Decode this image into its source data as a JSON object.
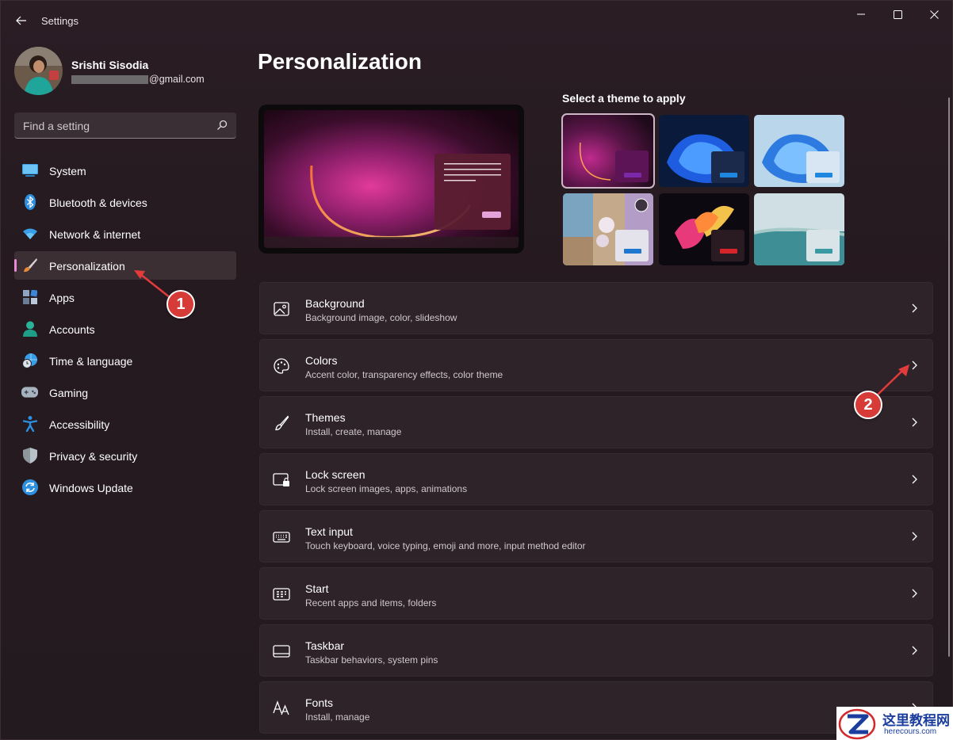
{
  "window": {
    "title": "Settings",
    "controls": [
      "minimize",
      "maximize",
      "close"
    ]
  },
  "profile": {
    "name": "Srishti Sisodia",
    "email_suffix": "@gmail.com"
  },
  "search": {
    "placeholder": "Find a setting"
  },
  "sidebar": {
    "items": [
      {
        "label": "System",
        "icon": "monitor-icon"
      },
      {
        "label": "Bluetooth & devices",
        "icon": "bluetooth-icon"
      },
      {
        "label": "Network & internet",
        "icon": "wifi-icon"
      },
      {
        "label": "Personalization",
        "icon": "paintbrush-icon",
        "active": true
      },
      {
        "label": "Apps",
        "icon": "apps-icon"
      },
      {
        "label": "Accounts",
        "icon": "person-icon"
      },
      {
        "label": "Time & language",
        "icon": "globe-clock-icon"
      },
      {
        "label": "Gaming",
        "icon": "gamepad-icon"
      },
      {
        "label": "Accessibility",
        "icon": "accessibility-icon"
      },
      {
        "label": "Privacy & security",
        "icon": "shield-icon"
      },
      {
        "label": "Windows Update",
        "icon": "update-icon"
      }
    ]
  },
  "main": {
    "title": "Personalization",
    "theme_heading": "Select a theme to apply",
    "settings": [
      {
        "title": "Background",
        "subtitle": "Background image, color, slideshow",
        "icon": "image-icon"
      },
      {
        "title": "Colors",
        "subtitle": "Accent color, transparency effects, color theme",
        "icon": "palette-icon"
      },
      {
        "title": "Themes",
        "subtitle": "Install, create, manage",
        "icon": "brush-icon"
      },
      {
        "title": "Lock screen",
        "subtitle": "Lock screen images, apps, animations",
        "icon": "lock-screen-icon"
      },
      {
        "title": "Text input",
        "subtitle": "Touch keyboard, voice typing, emoji and more, input method editor",
        "icon": "keyboard-icon"
      },
      {
        "title": "Start",
        "subtitle": "Recent apps and items, folders",
        "icon": "start-icon"
      },
      {
        "title": "Taskbar",
        "subtitle": "Taskbar behaviors, system pins",
        "icon": "taskbar-icon"
      },
      {
        "title": "Fonts",
        "subtitle": "Install, manage",
        "icon": "fonts-icon"
      }
    ]
  },
  "annotations": {
    "step1": "1",
    "step2": "2"
  },
  "watermark": {
    "title": "这里教程网",
    "url": "herecours.com"
  },
  "colors": {
    "accent": "#e98ad5",
    "annotation": "#d63b38",
    "background": "#231a1f"
  }
}
